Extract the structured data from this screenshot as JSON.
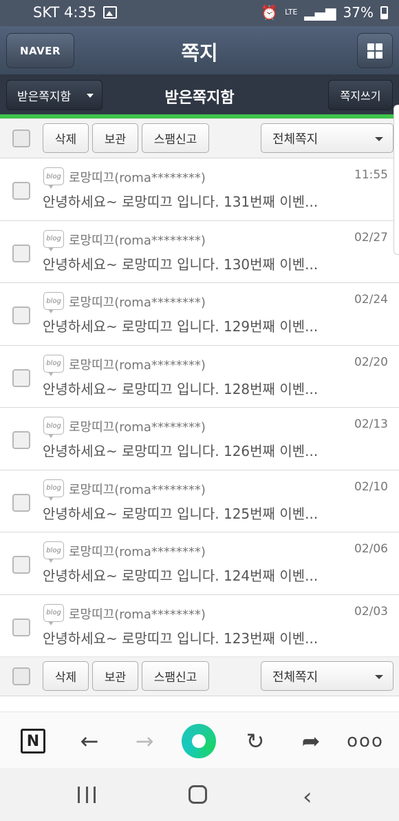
{
  "status_bar": {
    "carrier_time": "SKT 4:35",
    "network": "LTE",
    "battery": "37%"
  },
  "header": {
    "logo": "NAVER",
    "title": "쪽지"
  },
  "sub_header": {
    "folder_dropdown": "받은쪽지함",
    "title": "받은쪽지함",
    "write_button": "쪽지쓰기"
  },
  "toolbar": {
    "delete": "삭제",
    "keep": "보관",
    "spam": "스팸신고",
    "filter": "전체쪽지"
  },
  "messages": [
    {
      "badge": "blog",
      "sender": "로망띠끄(roma********)",
      "date": "11:55",
      "preview": "안녕하세요~ 로망띠끄 입니다. 131번째 이벤..."
    },
    {
      "badge": "blog",
      "sender": "로망띠끄(roma********)",
      "date": "02/27",
      "preview": "안녕하세요~ 로망띠끄 입니다. 130번째 이벤..."
    },
    {
      "badge": "blog",
      "sender": "로망띠끄(roma********)",
      "date": "02/24",
      "preview": "안녕하세요~ 로망띠끄 입니다. 129번째 이벤..."
    },
    {
      "badge": "blog",
      "sender": "로망띠끄(roma********)",
      "date": "02/20",
      "preview": "안녕하세요~ 로망띠끄 입니다. 128번째 이벤..."
    },
    {
      "badge": "blog",
      "sender": "로망띠끄(roma********)",
      "date": "02/13",
      "preview": "안녕하세요~ 로망띠끄 입니다. 126번째 이벤..."
    },
    {
      "badge": "blog",
      "sender": "로망띠끄(roma********)",
      "date": "02/10",
      "preview": "안녕하세요~ 로망띠끄 입니다. 125번째 이벤..."
    },
    {
      "badge": "blog",
      "sender": "로망띠끄(roma********)",
      "date": "02/06",
      "preview": "안녕하세요~ 로망띠끄 입니다. 124번째 이벤..."
    },
    {
      "badge": "blog",
      "sender": "로망띠끄(roma********)",
      "date": "02/03",
      "preview": "안녕하세요~ 로망띠끄 입니다. 123번째 이벤..."
    }
  ],
  "browser_bar": {
    "n_label": "N",
    "more_label": "ooo"
  },
  "icons": {
    "status": [
      "image-icon",
      "alarm-icon",
      "signal-icon",
      "battery-icon"
    ],
    "browser": [
      "naver-n-icon",
      "back-arrow-icon",
      "forward-arrow-icon",
      "green-home-icon",
      "reload-icon",
      "share-icon",
      "more-icon"
    ],
    "nav": [
      "recent-apps-icon",
      "home-icon",
      "back-icon"
    ]
  },
  "colors": {
    "header": "#4a5566",
    "sub_header": "#2f3744",
    "accent_green": "#3ec54b"
  }
}
